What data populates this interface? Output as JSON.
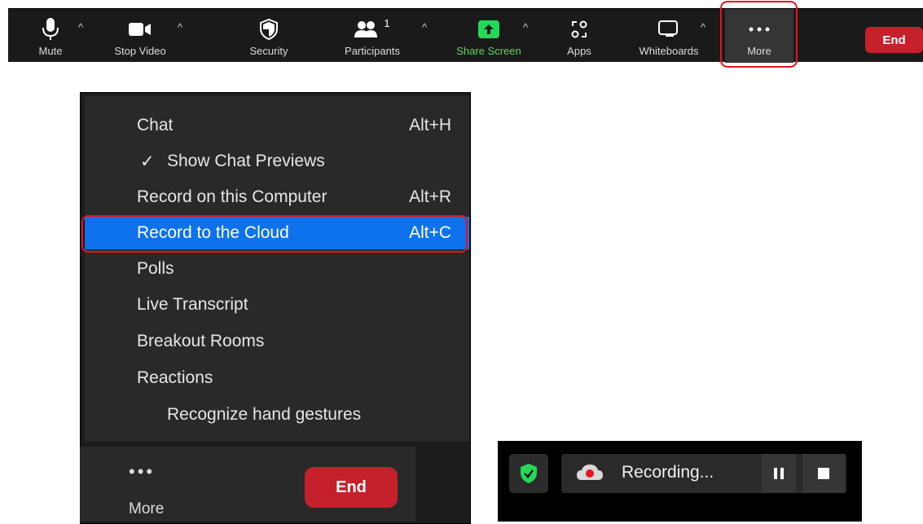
{
  "toolbar": {
    "mute_label": "Mute",
    "stop_video_label": "Stop Video",
    "security_label": "Security",
    "participants_label": "Participants",
    "participants_count": "1",
    "share_screen_label": "Share Screen",
    "apps_label": "Apps",
    "whiteboards_label": "Whiteboards",
    "more_label": "More",
    "end_label": "End",
    "caret": "^"
  },
  "menu": {
    "items": [
      {
        "label": "Chat",
        "shortcut": "Alt+H"
      },
      {
        "label": "Show Chat Previews",
        "check": "✓"
      },
      {
        "label": "Record on this Computer",
        "shortcut": "Alt+R"
      },
      {
        "label": "Record to the Cloud",
        "shortcut": "Alt+C"
      },
      {
        "label": "Polls"
      },
      {
        "label": "Live Transcript"
      },
      {
        "label": "Breakout Rooms"
      },
      {
        "label": "Reactions"
      },
      {
        "label": "Recognize hand gestures"
      }
    ]
  },
  "lower_toolbar": {
    "dots": "•••",
    "more_label": "More",
    "end_label": "End"
  },
  "recording": {
    "status_text": "Recording..."
  },
  "colors": {
    "toolbar_bg": "#1a1a1a",
    "end_red": "#c5212b",
    "selection_blue": "#0e72ed",
    "highlight_red": "#e8141c",
    "share_green": "#23d959"
  }
}
